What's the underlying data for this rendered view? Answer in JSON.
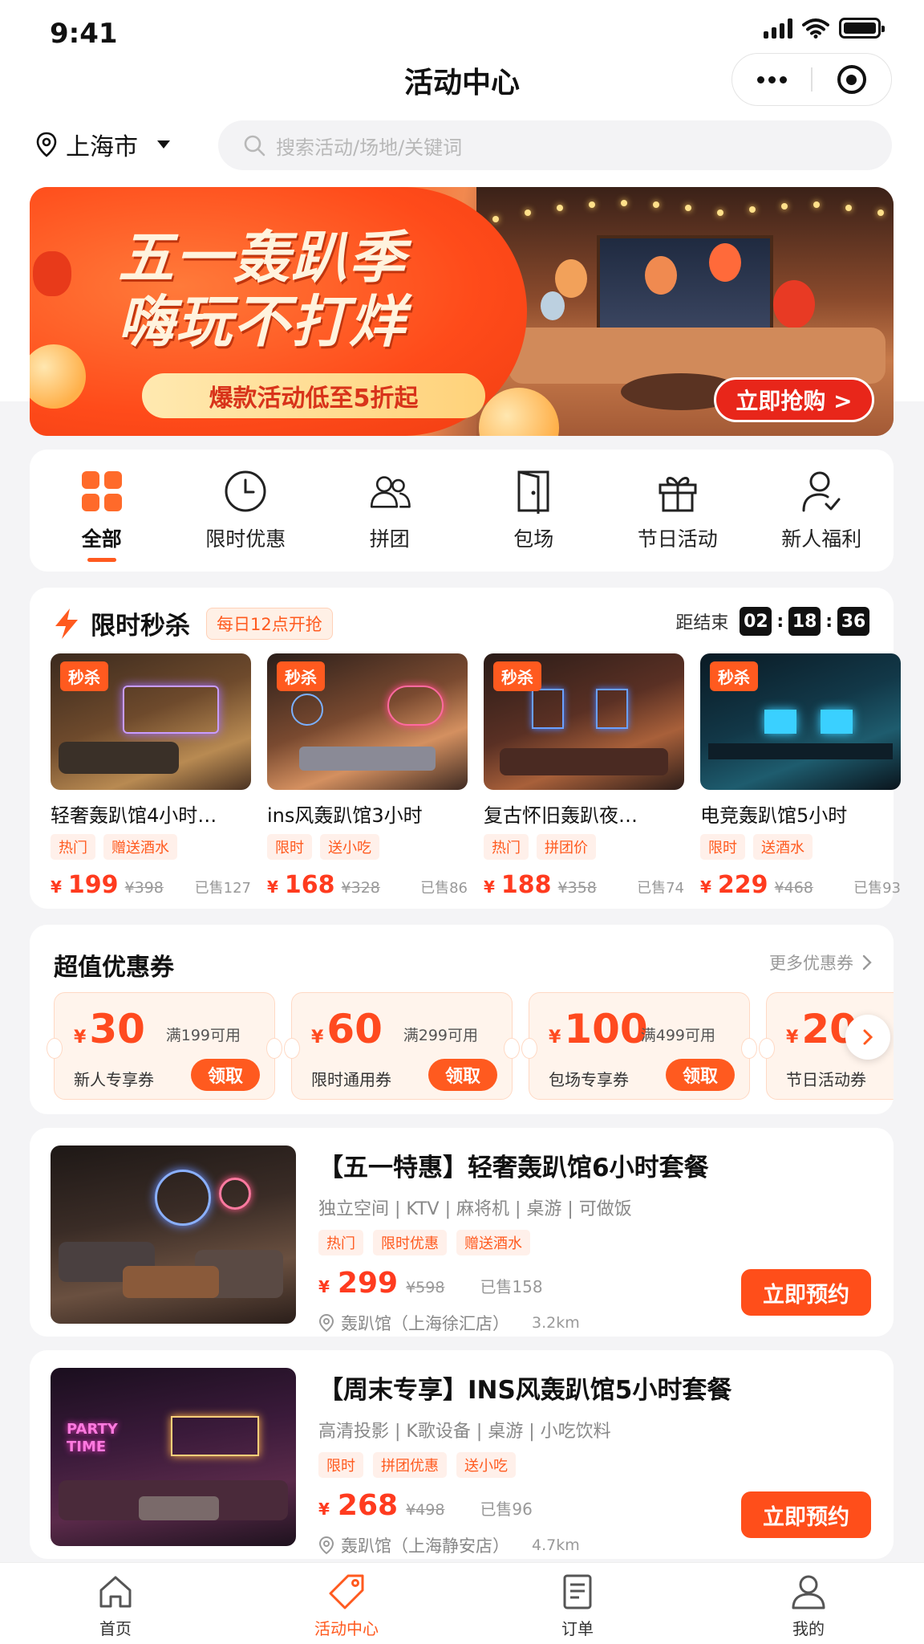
{
  "status_bar": {
    "time": "9:41"
  },
  "nav": {
    "title": "活动中心"
  },
  "location": {
    "city": "上海市"
  },
  "search": {
    "placeholder": "搜索活动/场地/关键词"
  },
  "banner": {
    "title_line1": "五一轰趴季",
    "title_line2": "嗨玩不打烊",
    "subtitle": "爆款活动低至5折起",
    "cta": "立即抢购 >"
  },
  "categories": [
    {
      "label": "全部",
      "icon": "grid-icon",
      "active": true
    },
    {
      "label": "限时优惠",
      "icon": "clock-icon"
    },
    {
      "label": "拼团",
      "icon": "group-icon"
    },
    {
      "label": "包场",
      "icon": "door-icon"
    },
    {
      "label": "节日活动",
      "icon": "gift-icon"
    },
    {
      "label": "新人福利",
      "icon": "user-check-icon"
    }
  ],
  "flash_sale": {
    "title": "限时秒杀",
    "tag": "每日12点开抢",
    "countdown_label": "距结束",
    "hours": "02",
    "minutes": "18",
    "seconds": "36",
    "items": [
      {
        "badge": "秒杀",
        "name": "轻奢轰趴馆4小时…",
        "tags": [
          "热门",
          "赠送酒水"
        ],
        "yen": "¥",
        "price": "199",
        "old_price": "¥398",
        "sold": "已售127"
      },
      {
        "badge": "秒杀",
        "name": "ins风轰趴馆3小时",
        "tags": [
          "限时",
          "送小吃"
        ],
        "yen": "¥",
        "price": "168",
        "old_price": "¥328",
        "sold": "已售86"
      },
      {
        "badge": "秒杀",
        "name": "复古怀旧轰趴夜…",
        "tags": [
          "热门",
          "拼团价"
        ],
        "yen": "¥",
        "price": "188",
        "old_price": "¥358",
        "sold": "已售74"
      },
      {
        "badge": "秒杀",
        "name": "电竞轰趴馆5小时",
        "tags": [
          "限时",
          "送酒水"
        ],
        "yen": "¥",
        "price": "229",
        "old_price": "¥468",
        "sold": "已售93"
      }
    ]
  },
  "coupons": {
    "title": "超值优惠券",
    "more": "更多优惠券",
    "items": [
      {
        "yen": "¥",
        "amount": "30",
        "condition": "满199可用",
        "name": "新人专享券",
        "button": "领取"
      },
      {
        "yen": "¥",
        "amount": "60",
        "condition": "满299可用",
        "name": "限时通用券",
        "button": "领取"
      },
      {
        "yen": "¥",
        "amount": "100",
        "condition": "满499可用",
        "name": "包场专享券",
        "button": "领取"
      },
      {
        "yen": "¥",
        "amount": "20",
        "condition": "",
        "name": "节日活动券",
        "button": ""
      }
    ]
  },
  "packages": [
    {
      "title": "【五一特惠】轻奢轰趴馆6小时套餐",
      "features": "独立空间 | KTV | 麻将机 | 桌游 | 可做饭",
      "tags": [
        "热门",
        "限时优惠",
        "赠送酒水"
      ],
      "yen": "¥",
      "price": "299",
      "old_price": "¥598",
      "sold": "已售158",
      "location": "轰趴馆（上海徐汇店）",
      "distance": "3.2km",
      "button": "立即预约"
    },
    {
      "title": "【周末专享】INS风轰趴馆5小时套餐",
      "features": "高清投影 | K歌设备 | 桌游 | 小吃饮料",
      "tags": [
        "限时",
        "拼团优惠",
        "送小吃"
      ],
      "yen": "¥",
      "price": "268",
      "old_price": "¥498",
      "sold": "已售96",
      "location": "轰趴馆（上海静安店）",
      "distance": "4.7km",
      "button": "立即预约",
      "image_text": "PARTY TIME"
    }
  ],
  "tabbar": [
    {
      "label": "首页",
      "icon": "home-icon"
    },
    {
      "label": "活动中心",
      "icon": "tag-icon",
      "active": true
    },
    {
      "label": "订单",
      "icon": "order-icon"
    },
    {
      "label": "我的",
      "icon": "profile-icon"
    }
  ],
  "colors": {
    "accent": "#ff5a1f",
    "price": "#ff3b1f",
    "background": "#f4f4f6"
  }
}
